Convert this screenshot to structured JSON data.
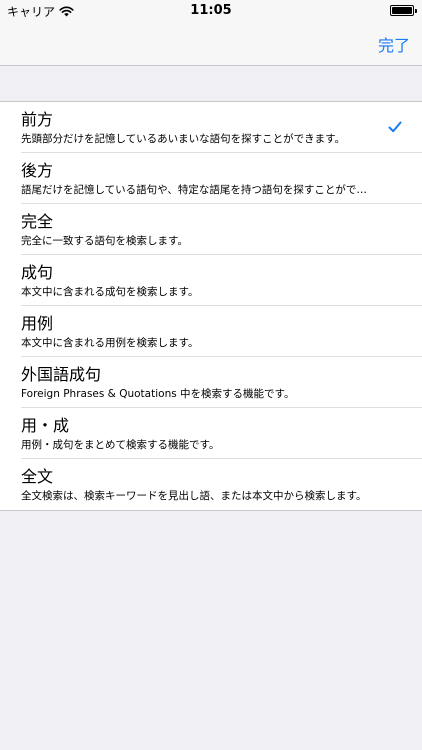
{
  "status_bar": {
    "carrier": "キャリア",
    "time": "11:05",
    "wifi_icon": "wifi-icon",
    "battery_icon": "battery-icon"
  },
  "nav": {
    "done_label": "完了"
  },
  "options": [
    {
      "title": "前方",
      "description": "先頭部分だけを記憶しているあいまいな語句を探すことができます。",
      "checked": true
    },
    {
      "title": "後方",
      "description": "語尾だけを記憶している語句や、特定な語尾を持つ語句を探すことがで…",
      "checked": false
    },
    {
      "title": "完全",
      "description": "完全に一致する語句を検索します。",
      "checked": false
    },
    {
      "title": "成句",
      "description": "本文中に含まれる成句を検索します。",
      "checked": false
    },
    {
      "title": "用例",
      "description": "本文中に含まれる用例を検索します。",
      "checked": false
    },
    {
      "title": "外国語成句",
      "description": "Foreign Phrases & Quotations 中を検索する機能です。",
      "checked": false
    },
    {
      "title": "用・成",
      "description": "用例・成句をまとめて検索する機能です。",
      "checked": false
    },
    {
      "title": "全文",
      "description": "全文検索は、検索キーワードを見出し語、または本文中から検索します。",
      "checked": false
    }
  ],
  "colors": {
    "accent": "#1a7bf6",
    "background": "#efeff4"
  }
}
